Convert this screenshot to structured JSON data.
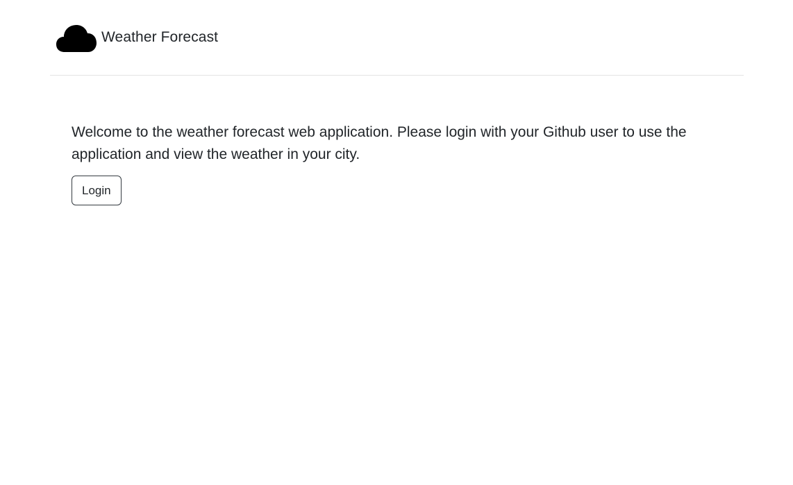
{
  "header": {
    "brand_icon": "cloud-icon",
    "brand_title": "Weather Forecast"
  },
  "main": {
    "intro_text": "Welcome to the weather forecast web application. Please login with your Github user to use the application and view the weather in your city.",
    "login_label": "Login"
  },
  "colors": {
    "text": "#212529",
    "divider": "#e3e3e3",
    "button_border": "#343a40",
    "background": "#ffffff"
  }
}
